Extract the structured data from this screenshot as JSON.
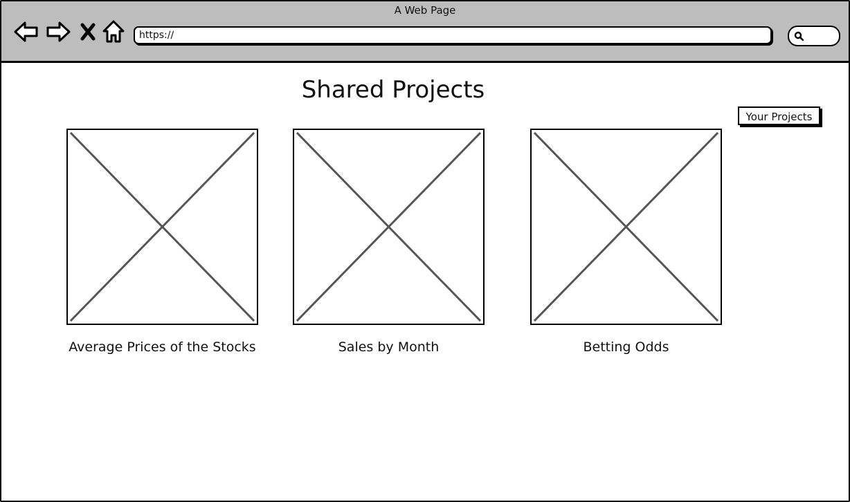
{
  "window": {
    "title": "A Web Page"
  },
  "browser": {
    "url": "https://",
    "nav_icons": [
      "back-arrow-icon",
      "forward-arrow-icon",
      "close-icon",
      "home-icon"
    ],
    "search_icon": "search-icon"
  },
  "main": {
    "title": "Shared Projects",
    "your_projects_label": "Your Projects",
    "projects": [
      {
        "label": "Average Prices of the Stocks",
        "thumbnail_icon": "image-placeholder-icon"
      },
      {
        "label": "Sales by Month",
        "thumbnail_icon": "image-placeholder-icon"
      },
      {
        "label": "Betting Odds",
        "thumbnail_icon": "image-placeholder-icon"
      }
    ]
  },
  "colors": {
    "chrome_background": "#bdbdbd",
    "page_background": "#ffffff",
    "stroke": "#000000",
    "placeholder_cross": "#555555"
  }
}
